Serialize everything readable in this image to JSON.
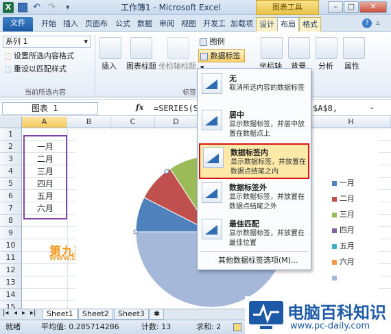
{
  "titlebar": {
    "title": "工作簿1 - Microsoft Excel",
    "context_group": "图表工具",
    "undo_icon": "undo-icon",
    "redo_icon": "redo-icon"
  },
  "tabs": [
    "文件",
    "开始",
    "插入",
    "页面布",
    "公式",
    "数据",
    "审阅",
    "视图",
    "开发工",
    "加载项",
    "设计",
    "布局",
    "格式"
  ],
  "ribbon": {
    "current_selection": {
      "selector": "系列 1",
      "format_selection": "设置所选内容格式",
      "reset_style": "重设以匹配样式",
      "group_label": "当前所选内容"
    },
    "insert": "插入",
    "chart_title": "图表标题",
    "axis_titles": "坐标轴标题",
    "legend": "图例",
    "data_labels": "数据标签",
    "labels_group": "标签",
    "axes": "坐标轴",
    "background": "背景",
    "analysis": "分析",
    "properties": "属性"
  },
  "formula_bar": {
    "name_box": "图表 1",
    "fx": "fx",
    "formula_left": "=SERIES(S",
    "formula_right": "$A$8,"
  },
  "columns": [
    "A",
    "B",
    "C",
    "D",
    "H"
  ],
  "rows": [
    "1",
    "2",
    "3",
    "4",
    "5",
    "6",
    "7",
    "8",
    "9",
    "10",
    "11",
    "12",
    "13",
    "14",
    "15",
    "16"
  ],
  "cells_A": [
    "一月",
    "二月",
    "三月",
    "四月",
    "五月",
    "六月"
  ],
  "legend": [
    {
      "label": "一月",
      "color": "#4f81bd"
    },
    {
      "label": "二月",
      "color": "#c0504d"
    },
    {
      "label": "三月",
      "color": "#9bbb59"
    },
    {
      "label": "四月",
      "color": "#8064a2"
    },
    {
      "label": "五月",
      "color": "#4bacc6"
    },
    {
      "label": "六月",
      "color": "#f79646"
    },
    {
      "label": "",
      "color": "#a5b8d9"
    }
  ],
  "dropdown": {
    "items": [
      {
        "title": "无",
        "desc": "取消所选内容的数据标签"
      },
      {
        "title": "居中",
        "desc": "显示数据标签，并居中放置在数据点上"
      },
      {
        "title": "数据标签内",
        "desc": "显示数据标签，并放置在数据点结尾之内"
      },
      {
        "title": "数据标签外",
        "desc": "显示数据标签，并放置在数据点结尾之外"
      },
      {
        "title": "最佳匹配",
        "desc": "显示数据标签，并放置在最佳位置"
      }
    ],
    "more": "其他数据标签选项(M)..."
  },
  "sheets": [
    "Sheet1",
    "Sheet2",
    "Sheet3"
  ],
  "status": {
    "ready": "就绪",
    "average": "平均值: 0.285714286",
    "count": "计数: 13",
    "sum": "求和: 2"
  },
  "watermark": {
    "site_cn": "第九软件网",
    "site_url": "WWW.D9SOFT.COM"
  },
  "logo": {
    "name": "电脑百科知识",
    "url": "www.pc-daily.com"
  }
}
